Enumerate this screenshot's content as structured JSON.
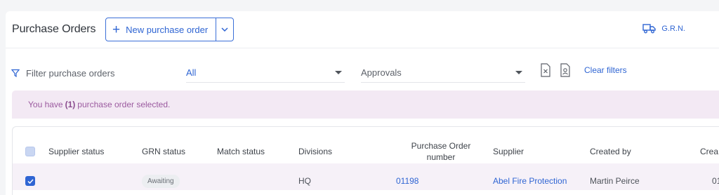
{
  "header": {
    "title": "Purchase Orders",
    "new_order_label": "New purchase order",
    "grn_label": "G.R.N."
  },
  "filters": {
    "search_placeholder": "Filter purchase orders",
    "status_value": "All",
    "approvals_value": "Approvals",
    "clear_label": "Clear filters"
  },
  "banner": {
    "prefix": "You have",
    "count": "(1)",
    "suffix": "purchase order selected."
  },
  "table": {
    "columns": [
      "Supplier status",
      "GRN status",
      "Match status",
      "Divisions",
      "Purchase Order number",
      "Supplier",
      "Created by",
      "Crea"
    ],
    "rows": [
      {
        "selected": true,
        "supplier_status": "",
        "grn_status": "Awaiting",
        "match_status": "",
        "division": "HQ",
        "po_number": "01198",
        "supplier": "Abel Fire Protection",
        "created_by": "Martin Peirce",
        "created_partial": "01"
      }
    ]
  },
  "colors": {
    "accent": "#2f65d3",
    "banner_bg": "#f3e9f4",
    "banner_text": "#9b5a9f"
  }
}
